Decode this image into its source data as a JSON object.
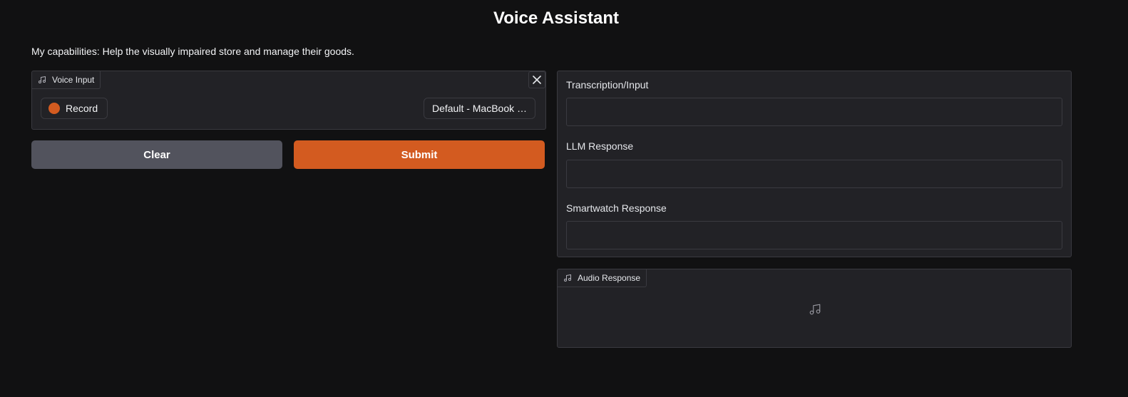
{
  "app": {
    "title": "Voice Assistant",
    "description": "My capabilities: Help the visually impaired store and manage their goods."
  },
  "voice_input": {
    "label": "Voice Input",
    "icon": "music-note-icon",
    "record_label": "Record",
    "device_label": "Default - MacBook …"
  },
  "actions": {
    "clear_label": "Clear",
    "submit_label": "Submit"
  },
  "outputs": {
    "transcription_label": "Transcription/Input",
    "transcription_value": "",
    "llm_label": "LLM Response",
    "llm_value": "",
    "smartwatch_label": "Smartwatch Response",
    "smartwatch_value": ""
  },
  "audio_response": {
    "label": "Audio Response",
    "icon": "music-note-icon"
  },
  "colors": {
    "background": "#111112",
    "panel": "#222226",
    "accent": "#d35b20",
    "secondary_button": "#52535d"
  }
}
